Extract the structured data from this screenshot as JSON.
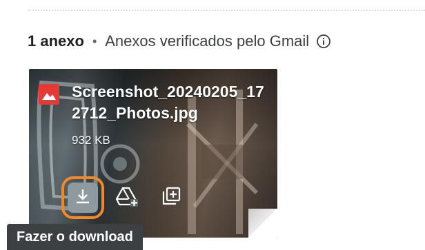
{
  "header": {
    "count_label": "1 anexo",
    "separator": "•",
    "scan_label": "Anexos verificados pelo Gmail"
  },
  "attachment": {
    "file_name": "Screenshot_20240205_172712_Photos.jpg",
    "file_size": "932 KB",
    "actions": [
      {
        "name": "download",
        "icon": "download-icon"
      },
      {
        "name": "add-to-drive",
        "icon": "drive-add-icon"
      },
      {
        "name": "add-to-photos",
        "icon": "add-to-photos-icon"
      }
    ]
  },
  "tooltip": {
    "text": "Fazer o download"
  },
  "colors": {
    "highlight": "#f08a24",
    "tooltip_bg": "#3c4043",
    "image_icon": "#e53935"
  }
}
